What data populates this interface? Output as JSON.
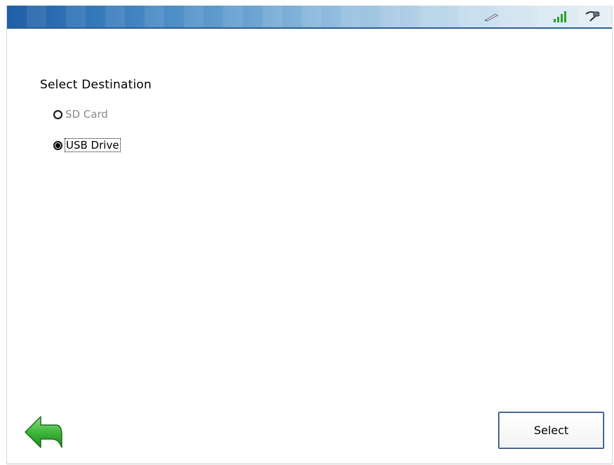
{
  "status_bar": {
    "icons": [
      "pen-icon",
      "signal-strength-icon",
      "power-plug-icon"
    ],
    "colors": {
      "gradient_start": "#1f5fa5",
      "gradient_end": "#e7f0f6",
      "signal": "#2aa52a"
    }
  },
  "page": {
    "title": "Select Destination"
  },
  "destinations": [
    {
      "label": "SD Card",
      "selected": false,
      "enabled": false
    },
    {
      "label": "USB Drive",
      "selected": true,
      "enabled": true
    }
  ],
  "footer": {
    "back_icon": "back-arrow-icon",
    "select_label": "Select"
  }
}
